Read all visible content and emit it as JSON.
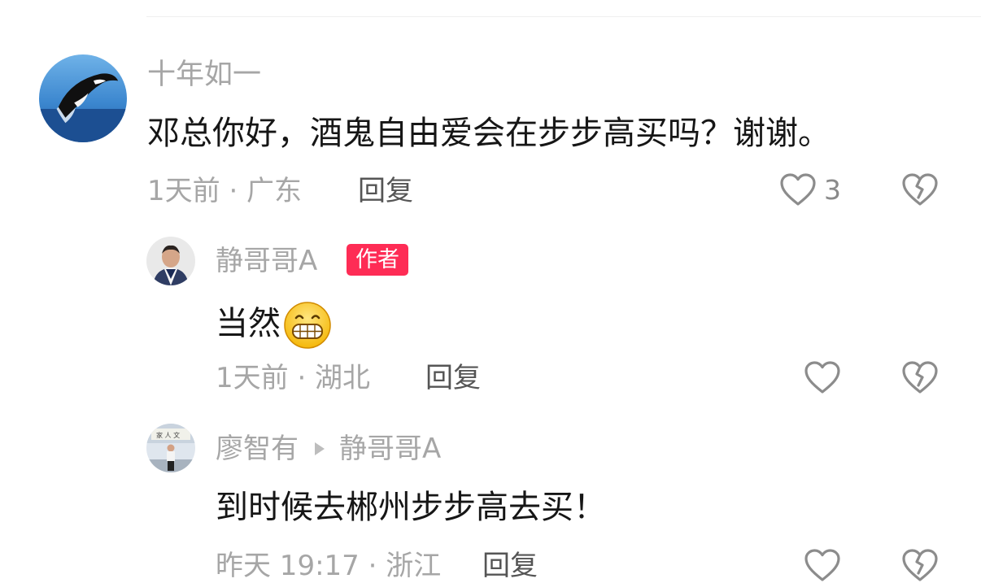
{
  "comments": [
    {
      "username": "十年如一",
      "text": "邓总你好，酒鬼自由爱会在步步高买吗？谢谢。",
      "meta": "1天前 · 广东",
      "reply_label": "回复",
      "likes": "3"
    }
  ],
  "replies": [
    {
      "username": "静哥哥A",
      "badge": "作者",
      "text": "当然",
      "emoji": "grinning-face",
      "meta": "1天前 · 湖北",
      "reply_label": "回复"
    },
    {
      "username": "廖智有",
      "reply_to": "静哥哥A",
      "text": "到时候去郴州步步高去买！",
      "meta": "昨天 19:17 · 浙江",
      "reply_label": "回复"
    }
  ],
  "colors": {
    "badge": "#fe2c55",
    "muted_text": "#a6a6a6",
    "body_text": "#161616"
  },
  "icons": [
    "heart-outline-icon",
    "broken-heart-icon",
    "play-arrow-icon",
    "grin-emoji"
  ]
}
